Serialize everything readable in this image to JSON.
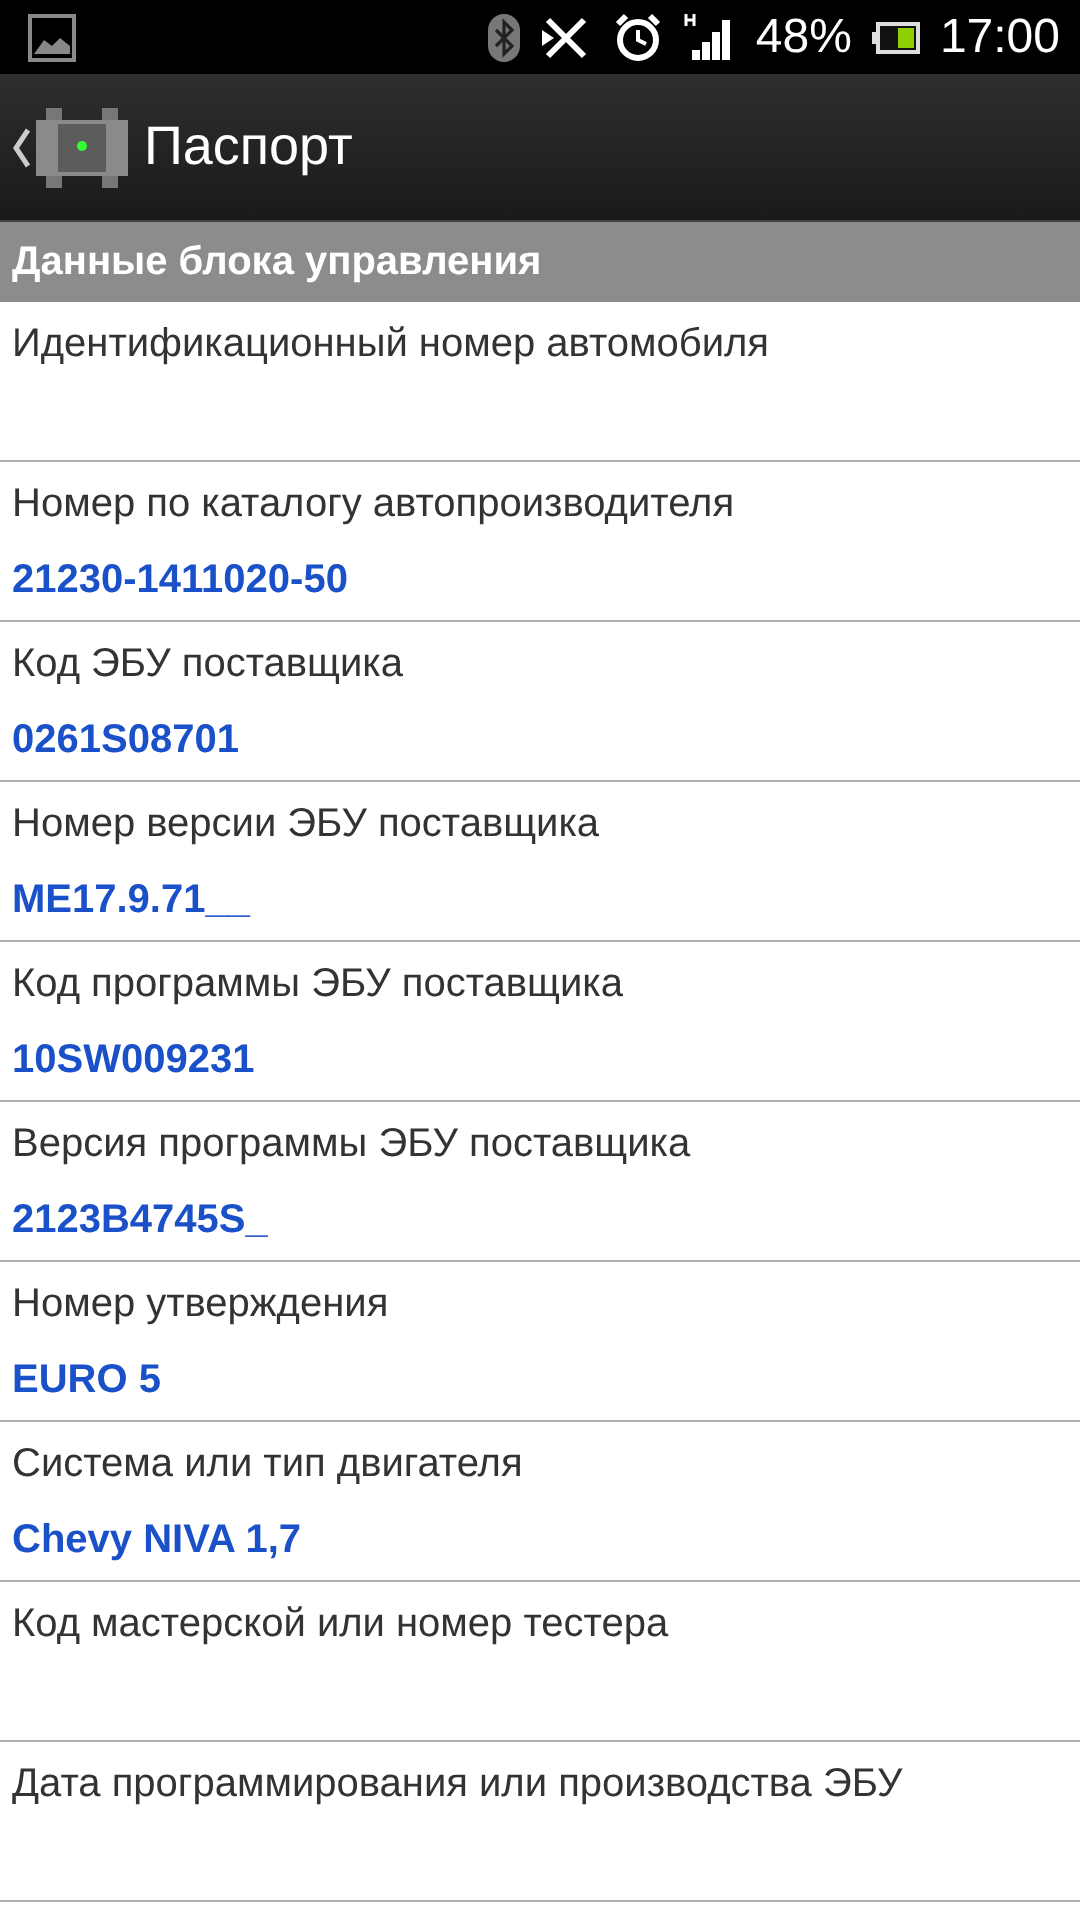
{
  "status_bar": {
    "battery": "48%",
    "time": "17:00"
  },
  "header": {
    "title": "Паспорт"
  },
  "section": {
    "title": "Данные блока управления"
  },
  "rows": [
    {
      "label": "Идентификационный номер автомобиля"
    },
    {
      "label": "Номер по каталогу автопроизводителя",
      "value": "21230-1411020-50"
    },
    {
      "label": "Код ЭБУ поставщика",
      "value": "0261S08701"
    },
    {
      "label": "Номер версии ЭБУ поставщика",
      "value": "ME17.9.71__"
    },
    {
      "label": "Код программы ЭБУ поставщика",
      "value": "10SW009231"
    },
    {
      "label": "Версия программы ЭБУ поставщика",
      "value": "2123B4745S_"
    },
    {
      "label": "Номер утверждения",
      "value": "EURO 5"
    },
    {
      "label": "Система или тип двигателя",
      "value": "Chevy NIVA 1,7"
    },
    {
      "label": "Код мастерской или номер тестера"
    },
    {
      "label": "Дата программирования или производства ЭБУ"
    }
  ]
}
